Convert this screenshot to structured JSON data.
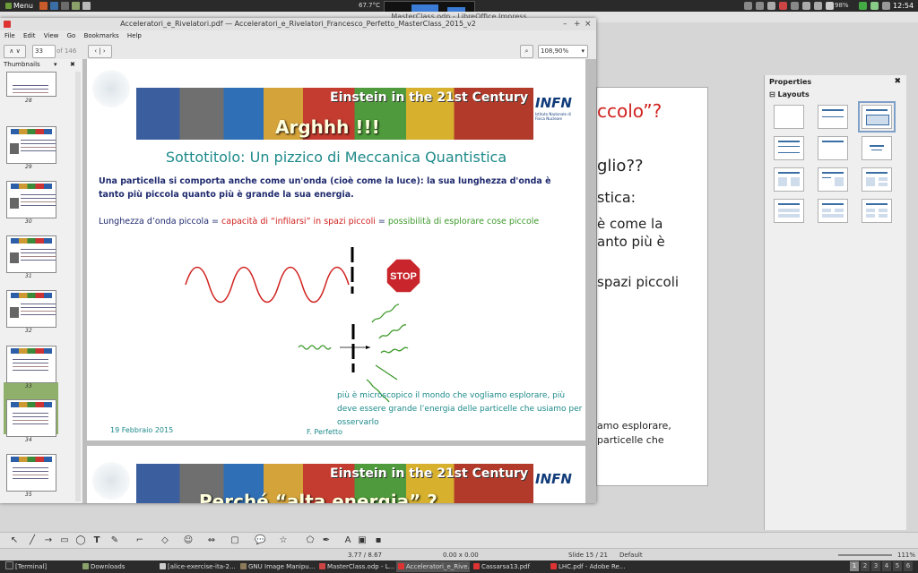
{
  "top_panel": {
    "menu_label": "Menu",
    "temperature": "67.7°C",
    "battery": "98%",
    "clock": "12:54"
  },
  "impress": {
    "title": "MasterClass.odp - LibreOffice Impress",
    "slide_text": {
      "line1": "ccolo”?",
      "line2": "glio??",
      "line3": "stica:",
      "line4": "è come la",
      "line5": "anto più è",
      "line6": "spazi piccoli",
      "line7": "amo esplorare,",
      "line8": "particelle che"
    },
    "properties": {
      "header": "Properties",
      "section": "Layouts"
    },
    "status": {
      "position": "3.77 / 8.67",
      "size": "0.00 x 0.00",
      "slide": "Slide 15 / 21",
      "master": "Default",
      "zoom": "111%"
    }
  },
  "evince": {
    "title": "Acceleratori_e_Rivelatori.pdf — Acceleratori_e_Rivelatori_Francesco_Perfetto_MasterClass_2015_v2",
    "menu": [
      "File",
      "Edit",
      "View",
      "Go",
      "Bookmarks",
      "Help"
    ],
    "toolbar": {
      "page_number": "33",
      "page_total": "of 146",
      "zoom": "108,90%"
    },
    "sidebar": {
      "label": "Thumbnails",
      "thumbnails": [
        "28",
        "29",
        "30",
        "31",
        "32",
        "33",
        "34",
        "35"
      ]
    },
    "page": {
      "banner_title": "Einstein in the 21st Century",
      "banner_subtitle": "Arghhh !!!",
      "infn": "INFN",
      "infn_sub": "Istituto Nazionale di Fisica Nucleare",
      "subtitle": "Sottotitolo: Un pizzico di Meccanica Quantistica",
      "paragraph": "Una particella si comporta anche come un'onda (cioè come la luce): la sua lunghezza d'onda è tanto più piccola quanto più è grande la sua energia.",
      "line_part1": "Lunghezza d’onda piccola",
      "line_eq1": " = ",
      "line_part2": "capacità di “infilarsi” in spazi piccoli",
      "line_eq2": " = ",
      "line_part3": "possibilità di esplorare cose piccole",
      "stop_label": "STOP",
      "note": "più è microscopico il mondo che vogliamo esplorare, più deve essere grande l’energia delle particelle che usiamo per osservarlo",
      "date": "19 Febbraio 2015",
      "author": "F. Perfetto"
    },
    "page2": {
      "banner_title": "Einstein in the 21st Century",
      "banner_subtitle": "Perché “alta energia” ?",
      "infn": "INFN"
    }
  },
  "taskbar": {
    "items": [
      "[Terminal]",
      "Downloads",
      "[alice-exercise-ita-2...",
      "GNU Image Manipu...",
      "MasterClass.odp - L...",
      "Acceleratori_e_Rive...",
      "Cassarsa13.pdf",
      "LHC.pdf - Adobe Re..."
    ],
    "workspaces": [
      "1",
      "2",
      "3",
      "4",
      "5",
      "6"
    ]
  },
  "colors": {
    "teal": "#1e8a8a",
    "navy": "#1f2a6e",
    "red": "#d0221f",
    "green": "#3e9a2c",
    "selection": "#8fb06a"
  }
}
